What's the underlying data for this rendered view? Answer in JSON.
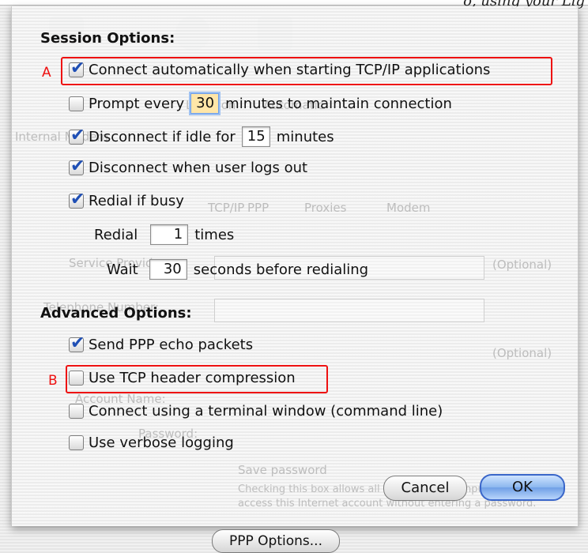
{
  "background": {
    "top_text": "o, using your Lig",
    "faint_labels": [
      "Location",
      "Automatic",
      "Internal Modem",
      "TCP/IP",
      "PPP",
      "Proxies",
      "Modem",
      "Service Provider:",
      "(Optional)",
      "Telephone Number:",
      "Account Name:",
      "(Optional)",
      "Password:",
      "Save password",
      "Checking this box allows all users of this computer to",
      "access this Internet account without entering a password."
    ]
  },
  "session_options": {
    "title": "Session Options:",
    "connect_auto": {
      "label": "Connect automatically when starting TCP/IP applications",
      "checked": true
    },
    "prompt": {
      "label_before": "Prompt every",
      "value": "30",
      "label_after": "minutes to maintain connection",
      "checked": false
    },
    "disconnect_idle": {
      "label_before": "Disconnect if idle for",
      "value": "15",
      "label_after": "minutes",
      "checked": true
    },
    "disconnect_logout": {
      "label": "Disconnect when user logs out",
      "checked": true
    },
    "redial": {
      "label": "Redial if busy",
      "checked": true
    },
    "redial_times": {
      "label_before": "Redial",
      "value": "1",
      "label_after": "times"
    },
    "wait": {
      "label_before": "Wait",
      "value": "30",
      "label_after": "seconds before redialing"
    }
  },
  "advanced_options": {
    "title": "Advanced Options:",
    "echo": {
      "label": "Send PPP echo packets",
      "checked": true
    },
    "tcp_header": {
      "label": "Use TCP header compression",
      "checked": false
    },
    "terminal": {
      "label": "Connect using a terminal window (command line)",
      "checked": false
    },
    "verbose": {
      "label": "Use verbose logging",
      "checked": false
    }
  },
  "markers": {
    "a": "A",
    "b": "B"
  },
  "buttons": {
    "cancel": "Cancel",
    "ok": "OK",
    "ppp_options": "PPP Options..."
  },
  "colors": {
    "highlight": "#ee1111",
    "default_button": "#6f9fe6",
    "checkmark": "#1f4fb5"
  }
}
